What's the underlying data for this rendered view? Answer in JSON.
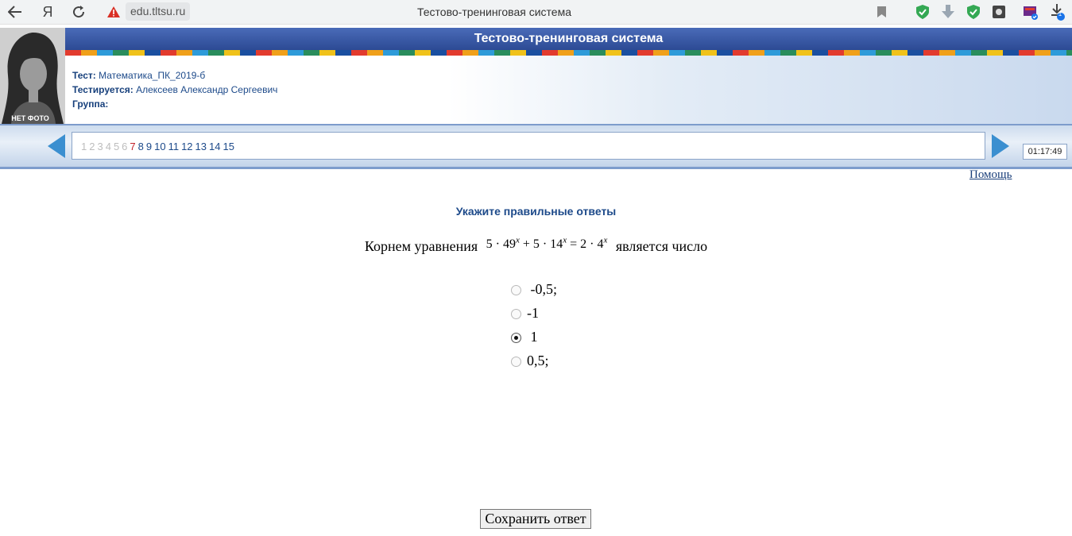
{
  "browser": {
    "url": "edu.tltsu.ru",
    "page_title": "Тестово-тренинговая система",
    "logo_letter": "Я",
    "download_badge": "1"
  },
  "photo": {
    "caption": "НЕТ ФОТО"
  },
  "header": {
    "title": "Тестово-тренинговая система",
    "test_label": "Тест:",
    "test_value": "Математика_ПК_2019-б",
    "student_label": "Тестируется:",
    "student_value": "Алексеев Александр Сергеевич",
    "group_label": "Группа:"
  },
  "nav": {
    "questions": [
      "1",
      "2",
      "3",
      "4",
      "5",
      "6",
      "7",
      "8",
      "9",
      "10",
      "11",
      "12",
      "13",
      "14",
      "15"
    ],
    "current": "7",
    "timer": "01:17:49"
  },
  "help_link": "Помощь",
  "instruction": "Укажите правильные ответы",
  "question": {
    "prefix": "Корнем уравнения",
    "suffix": "является число",
    "formula": {
      "t1": "5 · 49",
      "e1": "x",
      "op1": " + ",
      "t2": "5 · 14",
      "e2": "x",
      "op2": " = ",
      "t3": "2 · 4",
      "e3": "x"
    }
  },
  "answers": [
    {
      "label": " -0,5;",
      "selected": false
    },
    {
      "label": "-1",
      "selected": false
    },
    {
      "label": " 1",
      "selected": true
    },
    {
      "label": "0,5;",
      "selected": false
    }
  ],
  "save_button": "Сохранить ответ"
}
